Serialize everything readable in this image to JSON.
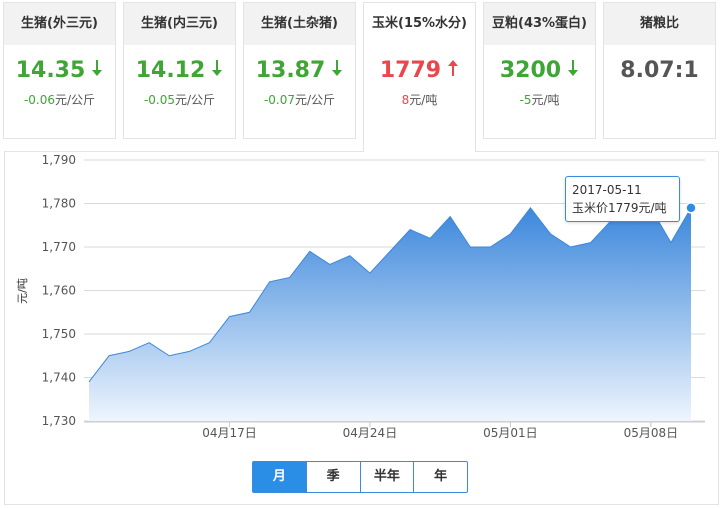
{
  "cards": [
    {
      "title": "生猪(外三元)",
      "value": "14.35",
      "direction": "down",
      "delta": "-0.06",
      "unit": "元/公斤",
      "active": false
    },
    {
      "title": "生猪(内三元)",
      "value": "14.12",
      "direction": "down",
      "delta": "-0.05",
      "unit": "元/公斤",
      "active": false
    },
    {
      "title": "生猪(土杂猪)",
      "value": "13.87",
      "direction": "down",
      "delta": "-0.07",
      "unit": "元/公斤",
      "active": false
    },
    {
      "title": "玉米(15%水分)",
      "value": "1779",
      "direction": "up",
      "delta": "8",
      "unit": "元/吨",
      "active": true
    },
    {
      "title": "豆粕(43%蛋白)",
      "value": "3200",
      "direction": "down",
      "delta": "-5",
      "unit": "元/吨",
      "active": false
    },
    {
      "title": "猪粮比",
      "value": "8.07:1",
      "direction": "none",
      "delta": "",
      "unit": "",
      "active": false
    }
  ],
  "colors": {
    "down": "#3fa535",
    "up": "#e9474d",
    "accent": "#2b8ee6",
    "area_top": "#3c87dc",
    "area_bottom": "#eef5fd"
  },
  "chart_data": {
    "type": "area",
    "ylabel": "元/吨",
    "ylim": [
      1730,
      1790
    ],
    "yticks": [
      1730,
      1740,
      1750,
      1760,
      1770,
      1780,
      1790
    ],
    "ytick_labels": [
      "1,730",
      "1,740",
      "1,750",
      "1,760",
      "1,770",
      "1,780",
      "1,790"
    ],
    "x_tick_labels": [
      {
        "label": "04月17日",
        "index": 7
      },
      {
        "label": "04月24日",
        "index": 14
      },
      {
        "label": "05月01日",
        "index": 21
      },
      {
        "label": "05月08日",
        "index": 28
      }
    ],
    "series": [
      {
        "values": [
          1739,
          1745,
          1746,
          1748,
          1745,
          1746,
          1748,
          1754,
          1755,
          1762,
          1763,
          1769,
          1766,
          1768,
          1764,
          1769,
          1774,
          1772,
          1777,
          1770,
          1770,
          1773,
          1779,
          1773,
          1770,
          1771,
          1776,
          1777,
          1779,
          1771,
          1779
        ]
      }
    ],
    "grid": true,
    "legend": "none"
  },
  "tooltip": {
    "date": "2017-05-11",
    "text": "玉米价1779元/吨"
  },
  "range_tabs": [
    {
      "label": "月",
      "selected": true
    },
    {
      "label": "季",
      "selected": false
    },
    {
      "label": "半年",
      "selected": false
    },
    {
      "label": "年",
      "selected": false
    }
  ]
}
